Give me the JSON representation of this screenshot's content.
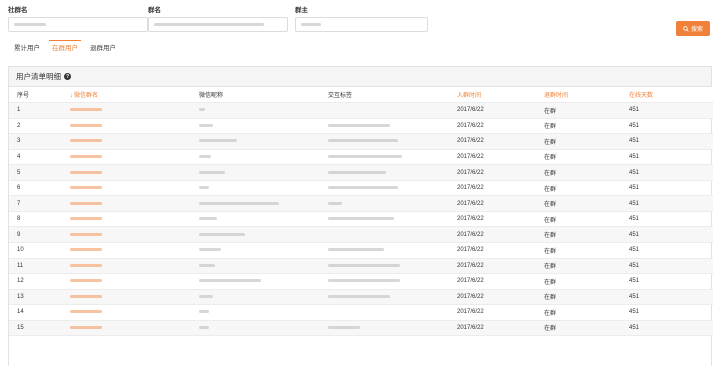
{
  "filters": {
    "community_label": "社群名",
    "group_label": "群名",
    "owner_label": "群主"
  },
  "search_button": {
    "label": "搜索",
    "icon": "search-icon",
    "color": "#f0813a"
  },
  "tabs": [
    {
      "label": "累计用户",
      "active": false
    },
    {
      "label": "在群用户",
      "active": true
    },
    {
      "label": "退群用户",
      "active": false
    }
  ],
  "panel": {
    "title": "用户清单明细",
    "help_icon": "question-circle-icon"
  },
  "table": {
    "headers": [
      "序号",
      "微信群名",
      "微信昵称",
      "交互标签",
      "入群时间",
      "退群时间",
      "在线天数"
    ],
    "rows": [
      [
        "1",
        "",
        "",
        "",
        "2017/6/22",
        "在群",
        "451"
      ],
      [
        "2",
        "",
        "",
        "",
        "2017/6/22",
        "在群",
        "451"
      ],
      [
        "3",
        "",
        "",
        "",
        "2017/6/22",
        "在群",
        "451"
      ],
      [
        "4",
        "",
        "",
        "",
        "2017/6/22",
        "在群",
        "451"
      ],
      [
        "5",
        "",
        "",
        "",
        "2017/6/22",
        "在群",
        "451"
      ],
      [
        "6",
        "",
        "",
        "",
        "2017/6/22",
        "在群",
        "451"
      ],
      [
        "7",
        "",
        "",
        "",
        "2017/6/22",
        "在群",
        "451"
      ],
      [
        "8",
        "",
        "",
        "",
        "2017/6/22",
        "在群",
        "451"
      ],
      [
        "9",
        "",
        "",
        "",
        "2017/6/22",
        "在群",
        "451"
      ],
      [
        "10",
        "",
        "",
        "",
        "2017/6/22",
        "在群",
        "451"
      ],
      [
        "11",
        "",
        "",
        "",
        "2017/6/22",
        "在群",
        "451"
      ],
      [
        "12",
        "",
        "",
        "",
        "2017/6/22",
        "在群",
        "451"
      ],
      [
        "13",
        "",
        "",
        "",
        "2017/6/22",
        "在群",
        "451"
      ],
      [
        "14",
        "",
        "",
        "",
        "2017/6/22",
        "在群",
        "451"
      ],
      [
        "15",
        "",
        "",
        "",
        "2017/6/22",
        "在群",
        "451"
      ]
    ]
  },
  "colors": {
    "accent": "#f0813a",
    "stripe": "#f7f7f7",
    "border": "#e2e2e2"
  }
}
